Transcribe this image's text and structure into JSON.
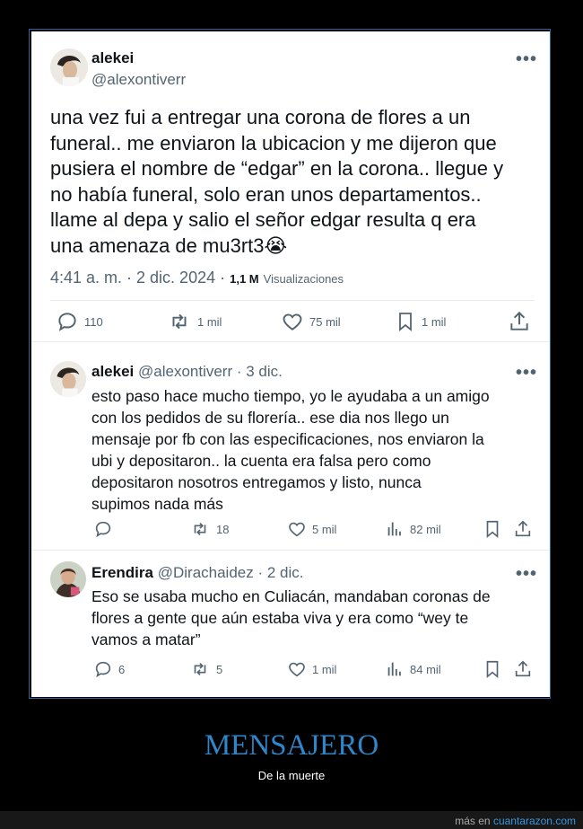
{
  "main_tweet": {
    "author_name": "alekei",
    "author_handle": "@alexontiverr",
    "text": "una vez fui a entregar una corona de flores a un\nfuneral.. me enviaron la ubicacion y me dijeron que\npusiera el nombre de “edgar” en la corona.. llegue y\nno había funeral, solo eran unos departamentos..\nllame al depa y salio el señor edgar resulta q era\nuna amenaza de mu3rt3😭",
    "timestamp": "4:41 a. m. · 2 dic. 2024 ·",
    "views_count": "1,1 M",
    "views_label": "Visualizaciones",
    "actions": {
      "replies": "110",
      "retweets": "1 mil",
      "likes": "75 mil",
      "bookmarks": "1 mil"
    }
  },
  "replies": [
    {
      "author_name": "alekei",
      "author_handle": "@alexontiverr · 3 dic.",
      "text": "esto paso hace mucho tiempo, yo le ayudaba a un amigo\ncon los pedidos de su florería.. ese dia nos llego un\nmensaje por fb con las especificaciones, nos enviaron la\nubi y depositaron.. la cuenta era falsa pero como\ndepositaron nosotros entregamos y listo, nunca\nsupimos nada más",
      "actions": {
        "replies": "",
        "retweets": "18",
        "likes": "5 mil",
        "views": "82 mil"
      }
    },
    {
      "author_name": "Erendira",
      "author_handle": "@Dirachaidez · 2 dic.",
      "text": "Eso se usaba mucho en Culiacán, mandaban coronas de\nflores a gente que aún estaba viva y era como “wey te\nvamos a matar”",
      "actions": {
        "replies": "6",
        "retweets": "5",
        "likes": "1 mil",
        "views": "84 mil"
      }
    }
  ],
  "more_label": "•••",
  "caption": {
    "title": "MENSAJERO",
    "subtitle": "De la muerte"
  },
  "footer": {
    "prefix": "más en",
    "site": "cuantarazon.com"
  },
  "colors": {
    "card_background": "#ffffff",
    "text": "#0f1419",
    "secondary_text": "#536471",
    "caption_blue": "#2f86c9",
    "frame_border": "#2f64a8"
  }
}
